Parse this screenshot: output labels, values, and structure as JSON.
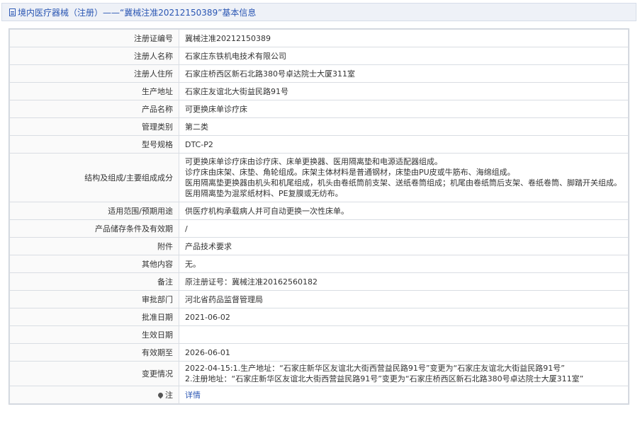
{
  "header": {
    "title": "境内医疗器械（注册）——“冀械注准20212150389”基本信息"
  },
  "rows": [
    {
      "label": "注册证编号",
      "value": "冀械注准20212150389"
    },
    {
      "label": "注册人名称",
      "value": "石家庄东铁机电技术有限公司"
    },
    {
      "label": "注册人住所",
      "value": "石家庄桥西区新石北路380号卓达院士大厦311室"
    },
    {
      "label": "生产地址",
      "value": "石家庄友谊北大街益民路91号"
    },
    {
      "label": "产品名称",
      "value": "可更换床单诊疗床"
    },
    {
      "label": "管理类别",
      "value": "第二类"
    },
    {
      "label": "型号规格",
      "value": "DTC-P2"
    },
    {
      "label": "结构及组成/主要组成成分",
      "lines": [
        "可更换床单诊疗床由诊疗床、床单更换器、医用隔离垫和电源适配器组成。",
        "诊疗床由床架、床垫、角轮组成。床架主体材料是普通钢材，床垫由PU皮或牛筋布、海绵组成。",
        "医用隔离垫更换器由机头和机尾组成，机头由卷纸筒前支架、送纸卷筒组成；机尾由卷纸筒后支架、卷纸卷筒、脚踏开关组成。",
        "医用隔离垫为混浆纸材料、PE复膜或无纺布。"
      ]
    },
    {
      "label": "适用范围/预期用途",
      "value": "供医疗机构承载病人并可自动更换一次性床单。"
    },
    {
      "label": "产品储存条件及有效期",
      "value": "/"
    },
    {
      "label": "附件",
      "value": "产品技术要求"
    },
    {
      "label": "其他内容",
      "value": "无。"
    },
    {
      "label": "备注",
      "value": "原注册证号：冀械注准20162560182"
    },
    {
      "label": "审批部门",
      "value": "河北省药品监督管理局"
    },
    {
      "label": "批准日期",
      "value": "2021-06-02"
    },
    {
      "label": "生效日期",
      "value": ""
    },
    {
      "label": "有效期至",
      "value": "2026-06-01"
    },
    {
      "label": "变更情况",
      "lines": [
        "2022-04-15:1.生产地址：“石家庄新华区友谊北大街西营益民路91号”变更为“石家庄友谊北大街益民路91号”",
        "2.注册地址：“石家庄新华区友谊北大街西营益民路91号”变更为“石家庄桥西区新石北路380号卓达院士大厦311室”"
      ]
    },
    {
      "label": "注",
      "link": "详情"
    }
  ],
  "colors": {
    "accent": "#2a56b3",
    "title_bg": "#eef1f7",
    "border": "#d9dde3"
  }
}
